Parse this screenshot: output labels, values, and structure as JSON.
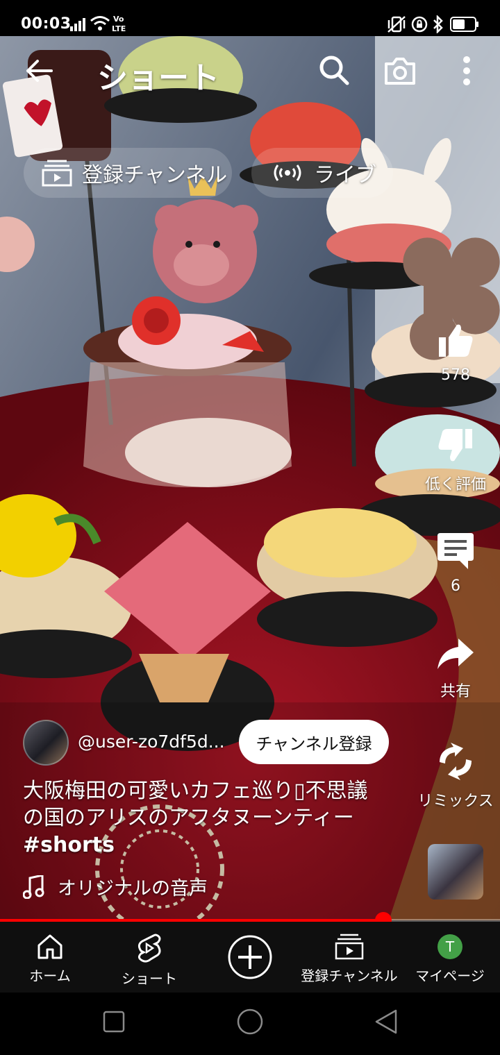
{
  "status_bar": {
    "time": "00:03",
    "network_label": "Vo LTE",
    "icons": [
      "signal-icon",
      "wifi-icon",
      "volte-icon",
      "vibrate-icon",
      "rotation-lock-icon",
      "bluetooth-icon",
      "battery-icon"
    ]
  },
  "header": {
    "title": "ショート",
    "icons": [
      "back-arrow-icon",
      "search-icon",
      "camera-icon",
      "more-vert-icon"
    ]
  },
  "chips": [
    {
      "label": "登録チャンネル",
      "icon": "subscriptions-icon"
    },
    {
      "label": "ライブ",
      "icon": "live-icon"
    }
  ],
  "actions": {
    "like": {
      "count": "578",
      "icon": "thumb-up-icon"
    },
    "dislike": {
      "label": "低く評価",
      "icon": "thumb-down-icon"
    },
    "comments": {
      "count": "6",
      "icon": "comment-icon"
    },
    "share": {
      "label": "共有",
      "icon": "share-icon"
    },
    "remix": {
      "label": "リミックス",
      "icon": "remix-icon"
    }
  },
  "video": {
    "channel_handle": "@user-zo7df5d...",
    "subscribe_label": "チャンネル登録",
    "caption_line1": "大阪梅田の可愛いカフェ巡り▯不思議",
    "caption_line2": "の国のアリスのアフタヌーンティー",
    "hashtag": "#shorts",
    "audio_label": "オリジナルの音声",
    "progress": 0.767
  },
  "bottom_nav": [
    {
      "label": "ホーム",
      "icon": "home-icon"
    },
    {
      "label": "ショート",
      "icon": "shorts-icon"
    },
    {
      "label": "",
      "icon": "create-plus-icon"
    },
    {
      "label": "登録チャンネル",
      "icon": "subscriptions-icon"
    },
    {
      "label": "マイページ",
      "icon": "avatar-icon",
      "avatar_letter": "T",
      "avatar_color": "#43a047"
    }
  ],
  "system_nav": [
    "recents-icon",
    "home-circle-icon",
    "back-triangle-icon"
  ],
  "colors": {
    "accent": "#ff0000",
    "nav_bg": "#0f0f0f"
  }
}
